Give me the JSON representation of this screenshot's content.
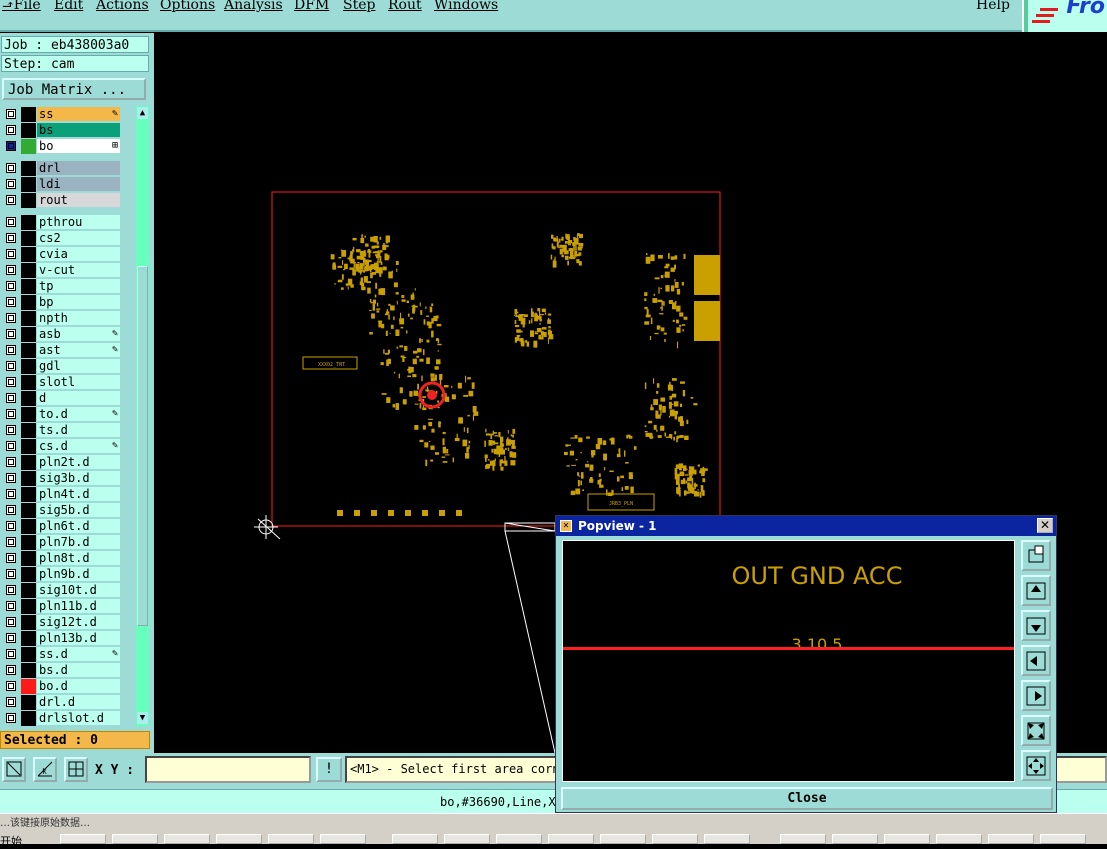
{
  "menubar": {
    "items": [
      "File",
      "Edit",
      "Actions",
      "Options",
      "Analysis",
      "DFM",
      "Step",
      "Rout",
      "Windows"
    ],
    "help": "Help"
  },
  "logo": {
    "text": "Fro"
  },
  "job": {
    "label": "Job : eb438003a0",
    "step": "Step: cam",
    "matrix_button": "Job Matrix ..."
  },
  "layers": [
    {
      "name": "ss",
      "color": "#f4b84a",
      "bg": "#f4b84a",
      "flag": "✎"
    },
    {
      "name": "bs",
      "color": "#0aa07a",
      "bg": "#0aa07a",
      "flag": ""
    },
    {
      "name": "bo",
      "color": "#33aa33",
      "bg": "#ffffff",
      "flag": "⊞",
      "active": true
    },
    {
      "name": "drl",
      "color": "#000",
      "bg": "#9bb3c0",
      "flag": ""
    },
    {
      "name": "ldi",
      "color": "#000",
      "bg": "#9bb3c0",
      "flag": ""
    },
    {
      "name": "rout",
      "color": "#000",
      "bg": "#d8d8d8",
      "flag": ""
    },
    {
      "name": "pthrou",
      "color": "#000",
      "bg": "#bfe",
      "flag": ""
    },
    {
      "name": "cs2",
      "color": "#000",
      "bg": "#bfe",
      "flag": ""
    },
    {
      "name": "cvia",
      "color": "#000",
      "bg": "#bfe",
      "flag": ""
    },
    {
      "name": "v-cut",
      "color": "#000",
      "bg": "#bfe",
      "flag": ""
    },
    {
      "name": "tp",
      "color": "#000",
      "bg": "#bfe",
      "flag": ""
    },
    {
      "name": "bp",
      "color": "#000",
      "bg": "#bfe",
      "flag": ""
    },
    {
      "name": "npth",
      "color": "#000",
      "bg": "#bfe",
      "flag": ""
    },
    {
      "name": "asb",
      "color": "#000",
      "bg": "#bfe",
      "flag": "✎"
    },
    {
      "name": "ast",
      "color": "#000",
      "bg": "#bfe",
      "flag": "✎"
    },
    {
      "name": "gdl",
      "color": "#000",
      "bg": "#bfe",
      "flag": ""
    },
    {
      "name": "slotl",
      "color": "#000",
      "bg": "#bfe",
      "flag": ""
    },
    {
      "name": "d",
      "color": "#000",
      "bg": "#bfe",
      "flag": ""
    },
    {
      "name": "to.d",
      "color": "#000",
      "bg": "#bfe",
      "flag": "✎"
    },
    {
      "name": "ts.d",
      "color": "#000",
      "bg": "#bfe",
      "flag": ""
    },
    {
      "name": "cs.d",
      "color": "#000",
      "bg": "#bfe",
      "flag": "✎"
    },
    {
      "name": "pln2t.d",
      "color": "#000",
      "bg": "#bfe",
      "flag": ""
    },
    {
      "name": "sig3b.d",
      "color": "#000",
      "bg": "#bfe",
      "flag": ""
    },
    {
      "name": "pln4t.d",
      "color": "#000",
      "bg": "#bfe",
      "flag": ""
    },
    {
      "name": "sig5b.d",
      "color": "#000",
      "bg": "#bfe",
      "flag": ""
    },
    {
      "name": "pln6t.d",
      "color": "#000",
      "bg": "#bfe",
      "flag": ""
    },
    {
      "name": "pln7b.d",
      "color": "#000",
      "bg": "#bfe",
      "flag": ""
    },
    {
      "name": "pln8t.d",
      "color": "#000",
      "bg": "#bfe",
      "flag": ""
    },
    {
      "name": "pln9b.d",
      "color": "#000",
      "bg": "#bfe",
      "flag": ""
    },
    {
      "name": "sig10t.d",
      "color": "#000",
      "bg": "#bfe",
      "flag": ""
    },
    {
      "name": "pln11b.d",
      "color": "#000",
      "bg": "#bfe",
      "flag": ""
    },
    {
      "name": "sig12t.d",
      "color": "#000",
      "bg": "#bfe",
      "flag": ""
    },
    {
      "name": "pln13b.d",
      "color": "#000",
      "bg": "#bfe",
      "flag": ""
    },
    {
      "name": "ss.d",
      "color": "#000",
      "bg": "#bfe",
      "flag": "✎"
    },
    {
      "name": "bs.d",
      "color": "#000",
      "bg": "#bfe",
      "flag": ""
    },
    {
      "name": "bo.d",
      "color": "#ff1a1a",
      "bg": "#bfe",
      "flag": ""
    },
    {
      "name": "drl.d",
      "color": "#000",
      "bg": "#bfe",
      "flag": ""
    },
    {
      "name": "drlslot.d",
      "color": "#000",
      "bg": "#bfe",
      "flag": ""
    }
  ],
  "selected": "Selected : 0",
  "board": {
    "outline_color": "#ff2020",
    "component_color": "#c9a000",
    "silk_labels": [
      "XXX02_TNT",
      "JRB3_PLN"
    ]
  },
  "bottom": {
    "xy_label": "X Y :",
    "xy_value": "",
    "message": "<M1> - Select first area corner"
  },
  "status": {
    "text": "bo,#36690,Line,X"
  },
  "taskbar": {
    "note": "…该键接原始数据…",
    "start": "开始"
  },
  "popview": {
    "title": "Popview - 1",
    "text": "OUT GND ACC",
    "partial_text": "3 10 5",
    "close_label": "Close",
    "line_color": "#ff2020",
    "text_color": "#c9a000",
    "tools": [
      "zoom-fit",
      "zoom-top",
      "zoom-bottom",
      "zoom-left",
      "zoom-right",
      "zoom-in",
      "pan"
    ]
  }
}
